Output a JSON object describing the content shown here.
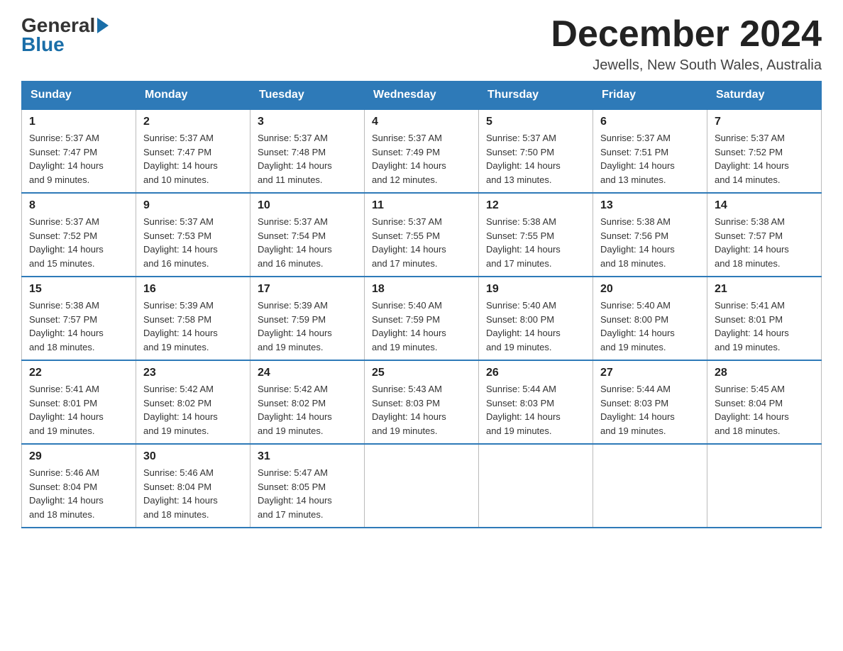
{
  "header": {
    "month_year": "December 2024",
    "location": "Jewells, New South Wales, Australia",
    "logo_general": "General",
    "logo_blue": "Blue"
  },
  "days_of_week": [
    "Sunday",
    "Monday",
    "Tuesday",
    "Wednesday",
    "Thursday",
    "Friday",
    "Saturday"
  ],
  "weeks": [
    [
      {
        "day": "1",
        "sunrise": "5:37 AM",
        "sunset": "7:47 PM",
        "daylight": "14 hours and 9 minutes."
      },
      {
        "day": "2",
        "sunrise": "5:37 AM",
        "sunset": "7:47 PM",
        "daylight": "14 hours and 10 minutes."
      },
      {
        "day": "3",
        "sunrise": "5:37 AM",
        "sunset": "7:48 PM",
        "daylight": "14 hours and 11 minutes."
      },
      {
        "day": "4",
        "sunrise": "5:37 AM",
        "sunset": "7:49 PM",
        "daylight": "14 hours and 12 minutes."
      },
      {
        "day": "5",
        "sunrise": "5:37 AM",
        "sunset": "7:50 PM",
        "daylight": "14 hours and 13 minutes."
      },
      {
        "day": "6",
        "sunrise": "5:37 AM",
        "sunset": "7:51 PM",
        "daylight": "14 hours and 13 minutes."
      },
      {
        "day": "7",
        "sunrise": "5:37 AM",
        "sunset": "7:52 PM",
        "daylight": "14 hours and 14 minutes."
      }
    ],
    [
      {
        "day": "8",
        "sunrise": "5:37 AM",
        "sunset": "7:52 PM",
        "daylight": "14 hours and 15 minutes."
      },
      {
        "day": "9",
        "sunrise": "5:37 AM",
        "sunset": "7:53 PM",
        "daylight": "14 hours and 16 minutes."
      },
      {
        "day": "10",
        "sunrise": "5:37 AM",
        "sunset": "7:54 PM",
        "daylight": "14 hours and 16 minutes."
      },
      {
        "day": "11",
        "sunrise": "5:37 AM",
        "sunset": "7:55 PM",
        "daylight": "14 hours and 17 minutes."
      },
      {
        "day": "12",
        "sunrise": "5:38 AM",
        "sunset": "7:55 PM",
        "daylight": "14 hours and 17 minutes."
      },
      {
        "day": "13",
        "sunrise": "5:38 AM",
        "sunset": "7:56 PM",
        "daylight": "14 hours and 18 minutes."
      },
      {
        "day": "14",
        "sunrise": "5:38 AM",
        "sunset": "7:57 PM",
        "daylight": "14 hours and 18 minutes."
      }
    ],
    [
      {
        "day": "15",
        "sunrise": "5:38 AM",
        "sunset": "7:57 PM",
        "daylight": "14 hours and 18 minutes."
      },
      {
        "day": "16",
        "sunrise": "5:39 AM",
        "sunset": "7:58 PM",
        "daylight": "14 hours and 19 minutes."
      },
      {
        "day": "17",
        "sunrise": "5:39 AM",
        "sunset": "7:59 PM",
        "daylight": "14 hours and 19 minutes."
      },
      {
        "day": "18",
        "sunrise": "5:40 AM",
        "sunset": "7:59 PM",
        "daylight": "14 hours and 19 minutes."
      },
      {
        "day": "19",
        "sunrise": "5:40 AM",
        "sunset": "8:00 PM",
        "daylight": "14 hours and 19 minutes."
      },
      {
        "day": "20",
        "sunrise": "5:40 AM",
        "sunset": "8:00 PM",
        "daylight": "14 hours and 19 minutes."
      },
      {
        "day": "21",
        "sunrise": "5:41 AM",
        "sunset": "8:01 PM",
        "daylight": "14 hours and 19 minutes."
      }
    ],
    [
      {
        "day": "22",
        "sunrise": "5:41 AM",
        "sunset": "8:01 PM",
        "daylight": "14 hours and 19 minutes."
      },
      {
        "day": "23",
        "sunrise": "5:42 AM",
        "sunset": "8:02 PM",
        "daylight": "14 hours and 19 minutes."
      },
      {
        "day": "24",
        "sunrise": "5:42 AM",
        "sunset": "8:02 PM",
        "daylight": "14 hours and 19 minutes."
      },
      {
        "day": "25",
        "sunrise": "5:43 AM",
        "sunset": "8:03 PM",
        "daylight": "14 hours and 19 minutes."
      },
      {
        "day": "26",
        "sunrise": "5:44 AM",
        "sunset": "8:03 PM",
        "daylight": "14 hours and 19 minutes."
      },
      {
        "day": "27",
        "sunrise": "5:44 AM",
        "sunset": "8:03 PM",
        "daylight": "14 hours and 19 minutes."
      },
      {
        "day": "28",
        "sunrise": "5:45 AM",
        "sunset": "8:04 PM",
        "daylight": "14 hours and 18 minutes."
      }
    ],
    [
      {
        "day": "29",
        "sunrise": "5:46 AM",
        "sunset": "8:04 PM",
        "daylight": "14 hours and 18 minutes."
      },
      {
        "day": "30",
        "sunrise": "5:46 AM",
        "sunset": "8:04 PM",
        "daylight": "14 hours and 18 minutes."
      },
      {
        "day": "31",
        "sunrise": "5:47 AM",
        "sunset": "8:05 PM",
        "daylight": "14 hours and 17 minutes."
      },
      null,
      null,
      null,
      null
    ]
  ],
  "labels": {
    "sunrise": "Sunrise:",
    "sunset": "Sunset:",
    "daylight": "Daylight:"
  }
}
